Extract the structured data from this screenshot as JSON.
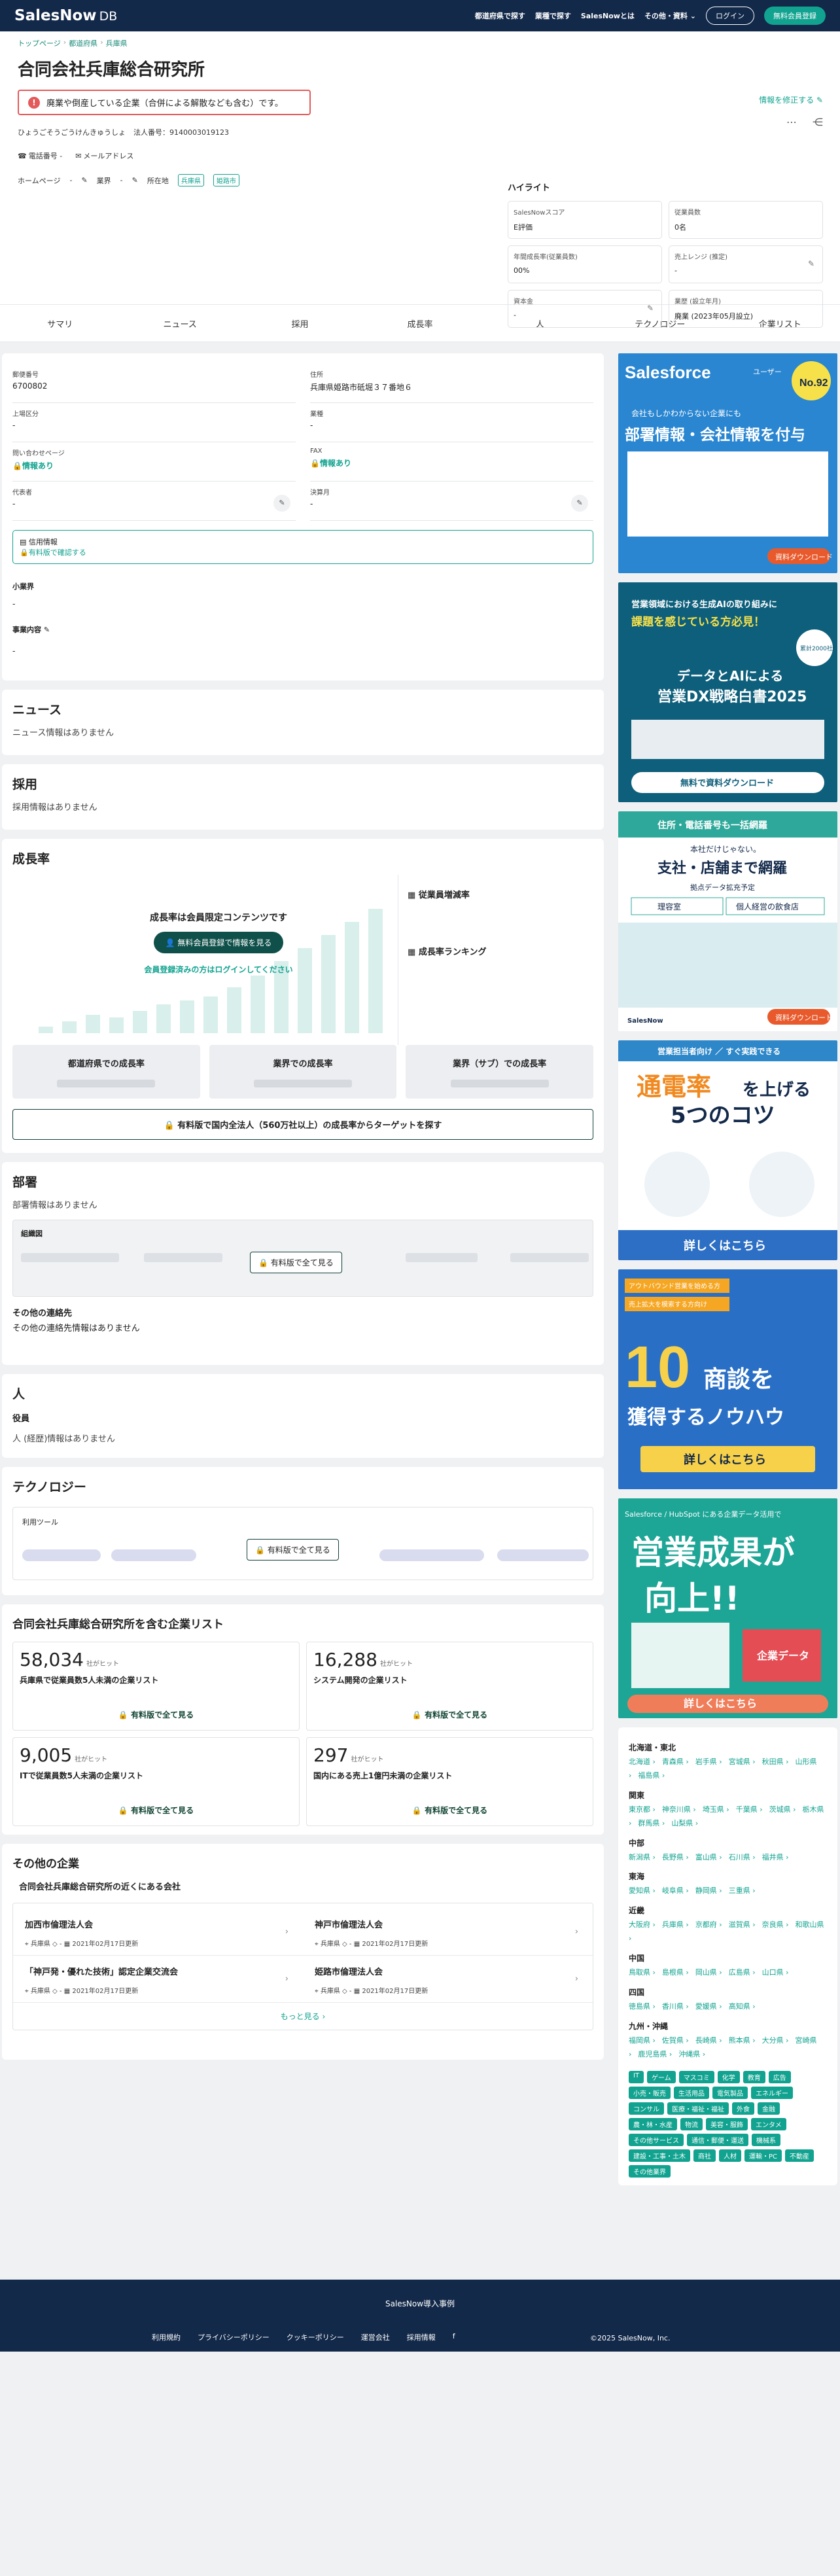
{
  "brand": {
    "name": "SalesNow",
    "suffix": "DB"
  },
  "nav": {
    "links": [
      "都道府県で探す",
      "業種で探す",
      "SalesNowとは",
      "その他・資料"
    ],
    "login": "ログイン",
    "register": "無料会員登録"
  },
  "breadcrumb": [
    "トップページ",
    "都道府県",
    "兵庫県"
  ],
  "company": {
    "name": "合同会社兵庫総合研究所",
    "alert": "廃業や倒産している企業（合併による解散なども含む）です。",
    "kana": "ひょうごそうごうけんきゅうしょ",
    "corp_number": "法人番号：9140003019123",
    "fix": "情報を修正する"
  },
  "contact": {
    "phone": "電話番号",
    "phone_v": "-",
    "email": "メールアドレス"
  },
  "meta": {
    "hp": "ホームページ",
    "hp_v": "-",
    "ind": "業界",
    "ind_v": "-",
    "loc": "所在地",
    "tags": [
      "兵庫県",
      "姫路市"
    ]
  },
  "highlight": {
    "title": "ハイライト",
    "cells": [
      {
        "label": "SalesNowスコア",
        "value": "E評価"
      },
      {
        "label": "従業員数",
        "value": "0名"
      },
      {
        "label": "年間成長率(従業員数)",
        "value": "00%"
      },
      {
        "label": "売上レンジ (推定)",
        "value": "-"
      },
      {
        "label": "資本金",
        "value": "-"
      },
      {
        "label": "業歴 (設立年月)",
        "value": "廃業 (2023年05月設立)"
      }
    ]
  },
  "tabs": [
    "サマリ",
    "ニュース",
    "採用",
    "成長率",
    "人",
    "テクノロジー",
    "企業リスト"
  ],
  "info": {
    "postal_l": "郵便番号",
    "postal": "6700802",
    "addr_l": "住所",
    "addr": "兵庫県姫路市砥堀３７番地６",
    "listing_l": "上場区分",
    "listing": "-",
    "industry_l": "業種",
    "industry": "-",
    "inquiry_l": "問い合わせページ",
    "inquiry": "情報あり",
    "fax_l": "FAX",
    "fax": "情報あり",
    "rep_l": "代表者",
    "rep": "-",
    "fiscal_l": "決算月",
    "fiscal": "-",
    "credit_l": "信用情報",
    "credit": "有料版で確認する",
    "sub_l": "小業界",
    "sub": "-",
    "biz_l": "事業内容",
    "biz": "-"
  },
  "news": {
    "title": "ニュース",
    "empty": "ニュース情報はありません"
  },
  "hiring": {
    "title": "採用",
    "empty": "採用情報はありません"
  },
  "growth": {
    "title": "成長率",
    "lock_title": "成長率は会員限定コンテンツです",
    "lock_btn": "無料会員登録で情報を見る",
    "lock_link": "会員登録済みの方はログインしてください",
    "side1": "従業員増減率",
    "side2": "成長率ランキング",
    "regions": [
      "都道府県での成長率",
      "業界での成長率",
      "業界（サブ）での成長率"
    ],
    "paid": "有料版で国内全法人（560万社以上）の成長率からターゲットを探す"
  },
  "dept": {
    "title": "部署",
    "empty": "部署情報はありません",
    "org": "組織図",
    "paid": "有料版で全て見る",
    "contact_t": "その他の連絡先",
    "contact_e": "その他の連絡先情報はありません"
  },
  "people": {
    "title": "人",
    "role": "役員",
    "empty": "人 (経歴)情報はありません"
  },
  "tech": {
    "title": "テクノロジー",
    "tools": "利用ツール",
    "paid": "有料版で全て見る"
  },
  "lists": {
    "title": "合同会社兵庫総合研究所を含む企業リスト",
    "unit": "社がヒット",
    "paid": "有料版で全て見る",
    "items": [
      {
        "n": "58,034",
        "d": "兵庫県で従業員数5人未満の企業リスト"
      },
      {
        "n": "16,288",
        "d": "システム開発の企業リスト"
      },
      {
        "n": "9,005",
        "d": "ITで従業員数5人未満の企業リスト"
      },
      {
        "n": "297",
        "d": "国内にある売上1億円未満の企業リスト"
      }
    ]
  },
  "others": {
    "title": "その他の企業",
    "sub": "合同会社兵庫総合研究所の近くにある会社",
    "items": [
      {
        "n": "加西市倫理法人会",
        "pref": "兵庫県",
        "ind": "-",
        "date": "2021年02月17日更新"
      },
      {
        "n": "神戸市倫理法人会",
        "pref": "兵庫県",
        "ind": "-",
        "date": "2021年02月17日更新"
      },
      {
        "n": "「神戸発・優れた技術」認定企業交流会",
        "pref": "兵庫県",
        "ind": "-",
        "date": "2021年02月17日更新"
      },
      {
        "n": "姫路市倫理法人会",
        "pref": "兵庫県",
        "ind": "-",
        "date": "2021年02月17日更新"
      }
    ],
    "more": "もっと見る"
  },
  "ads": {
    "a1": {
      "brand": "Salesforce",
      "brand2": "ユーザー",
      "rank": "No.92",
      "l1": "会社もしかわからない企業にも",
      "l2": "部署情報・会社情報を付与",
      "cta": "資料ダウンロード"
    },
    "a2": {
      "l1": "営業領域における生成AIの取り組みに",
      "l2": "課題を感じている方必見！",
      "badge": "累計2000社以上",
      "l3": "データとAIによる",
      "l4": "営業DX戦略白書2025",
      "cta": "無料で資料ダウンロード"
    },
    "a3": {
      "top": "住所・電話番号も一括網羅",
      "l1": "本社だけじゃない。",
      "l2": "支社・店舗まで網羅",
      "l3": "拠点データ拡充予定",
      "c1": "理容室",
      "c2": "個人経営の飲食店",
      "cta": "資料ダウンロード",
      "logo": "SalesNow"
    },
    "a4": {
      "top": "営業担当者向け ／ すぐ実践できる",
      "l1": "通電率",
      "l2": "を上げる",
      "l3": "5つのコツ",
      "cta": "詳しくはこちら"
    },
    "a5": {
      "t1": "アウトバウンド営業を始める方",
      "t2": "売上拡大を模索する方向け",
      "num": "10",
      "l1": "商談を",
      "l2": "獲得するノウハウ",
      "cta": "詳しくはこちら"
    },
    "a6": {
      "top": "Salesforce / HubSpot にある企業データ活用で",
      "l1": "営業成果が",
      "l2": "向上!!",
      "tag": "企業データ",
      "cta": "詳しくはこちら"
    }
  },
  "prefs": [
    {
      "r": "北海道・東北",
      "p": [
        "北海道",
        "青森県",
        "岩手県",
        "宮城県",
        "秋田県",
        "山形県",
        "福島県"
      ]
    },
    {
      "r": "関東",
      "p": [
        "東京都",
        "神奈川県",
        "埼玉県",
        "千葉県",
        "茨城県",
        "栃木県",
        "群馬県",
        "山梨県"
      ]
    },
    {
      "r": "中部",
      "p": [
        "新潟県",
        "長野県",
        "富山県",
        "石川県",
        "福井県"
      ]
    },
    {
      "r": "東海",
      "p": [
        "愛知県",
        "岐阜県",
        "静岡県",
        "三重県"
      ]
    },
    {
      "r": "近畿",
      "p": [
        "大阪府",
        "兵庫県",
        "京都府",
        "滋賀県",
        "奈良県",
        "和歌山県"
      ]
    },
    {
      "r": "中国",
      "p": [
        "鳥取県",
        "島根県",
        "岡山県",
        "広島県",
        "山口県"
      ]
    },
    {
      "r": "四国",
      "p": [
        "徳島県",
        "香川県",
        "愛媛県",
        "高知県"
      ]
    },
    {
      "r": "九州・沖縄",
      "p": [
        "福岡県",
        "佐賀県",
        "長崎県",
        "熊本県",
        "大分県",
        "宮崎県",
        "鹿児島県",
        "沖縄県"
      ]
    }
  ],
  "chips": [
    "IT",
    "ゲーム",
    "マスコミ",
    "化学",
    "教育",
    "広告",
    "小売・販売",
    "生活用品",
    "電気製品",
    "エネルギー",
    "コンサル",
    "医療・福祉・福祉",
    "外食",
    "金融",
    "農・林・水産",
    "物流",
    "美容・服飾",
    "エンタメ",
    "その他サービス",
    "通信・郵便・運送",
    "機械系",
    "建設・工事・土木",
    "商社",
    "人材",
    "運輸・PC",
    "不動産",
    "その他業界"
  ],
  "footer": {
    "top": "SalesNow導入事例",
    "links": [
      "利用規約",
      "プライバシーポリシー",
      "クッキーポリシー",
      "運営会社",
      "採用情報"
    ],
    "copy": "©2025 SalesNow, Inc."
  }
}
